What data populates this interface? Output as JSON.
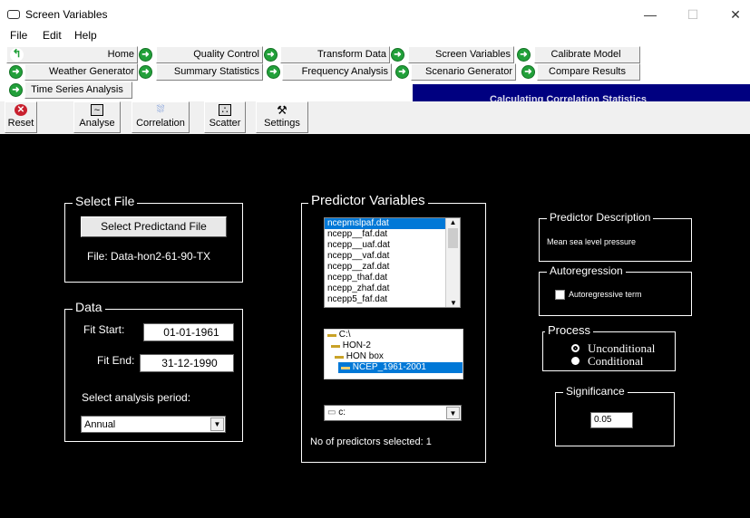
{
  "window": {
    "title": "Screen Variables",
    "minimize": "—",
    "maximize": "☐",
    "close": "✕"
  },
  "menu": [
    "File",
    "Edit",
    "Help"
  ],
  "nav_row1": [
    "Home",
    "Quality Control",
    "Transform Data",
    "Screen Variables",
    "Calibrate Model"
  ],
  "nav_row2": [
    "Weather Generator",
    "Summary Statistics",
    "Frequency Analysis",
    "Scenario Generator",
    "Compare Results"
  ],
  "nav_row3": [
    "Time Series Analysis"
  ],
  "status": "Calculating Correlation Statistics",
  "toolbar": {
    "reset": "Reset",
    "analyse": "Analyse",
    "correlation": "Correlation",
    "scatter": "Scatter",
    "settings": "Settings"
  },
  "select_file": {
    "label": "Select File",
    "button": "Select Predictand File",
    "file_text": "File:  Data-hon2-61-90-TX"
  },
  "data": {
    "label": "Data",
    "fit_start_label": "Fit Start:",
    "fit_start": "01-01-1961",
    "fit_end_label": "Fit End:",
    "fit_end": "31-12-1990",
    "analysis_label": "Select analysis period:",
    "analysis_period": "Annual"
  },
  "predictors": {
    "label": "Predictor Variables",
    "items": [
      "ncepmslpaf.dat",
      "ncepp__faf.dat",
      "ncepp__uaf.dat",
      "ncepp__vaf.dat",
      "ncepp__zaf.dat",
      "ncepp_thaf.dat",
      "ncepp_zhaf.dat",
      "ncepp5_faf.dat"
    ],
    "dirs": [
      "C:\\",
      "HON-2",
      "HON  box",
      "NCEP_1961-2001"
    ],
    "drive": "c:",
    "count_text": "No of predictors selected: 1"
  },
  "description": {
    "label": "Predictor Description",
    "text": "Mean sea level pressure"
  },
  "autoregression": {
    "label": "Autoregression",
    "checkbox": "Autoregressive term"
  },
  "process": {
    "label": "Process",
    "options": [
      "Unconditional",
      "Conditional"
    ],
    "selected": "Unconditional"
  },
  "significance": {
    "label": "Significance",
    "value": "0.05"
  }
}
